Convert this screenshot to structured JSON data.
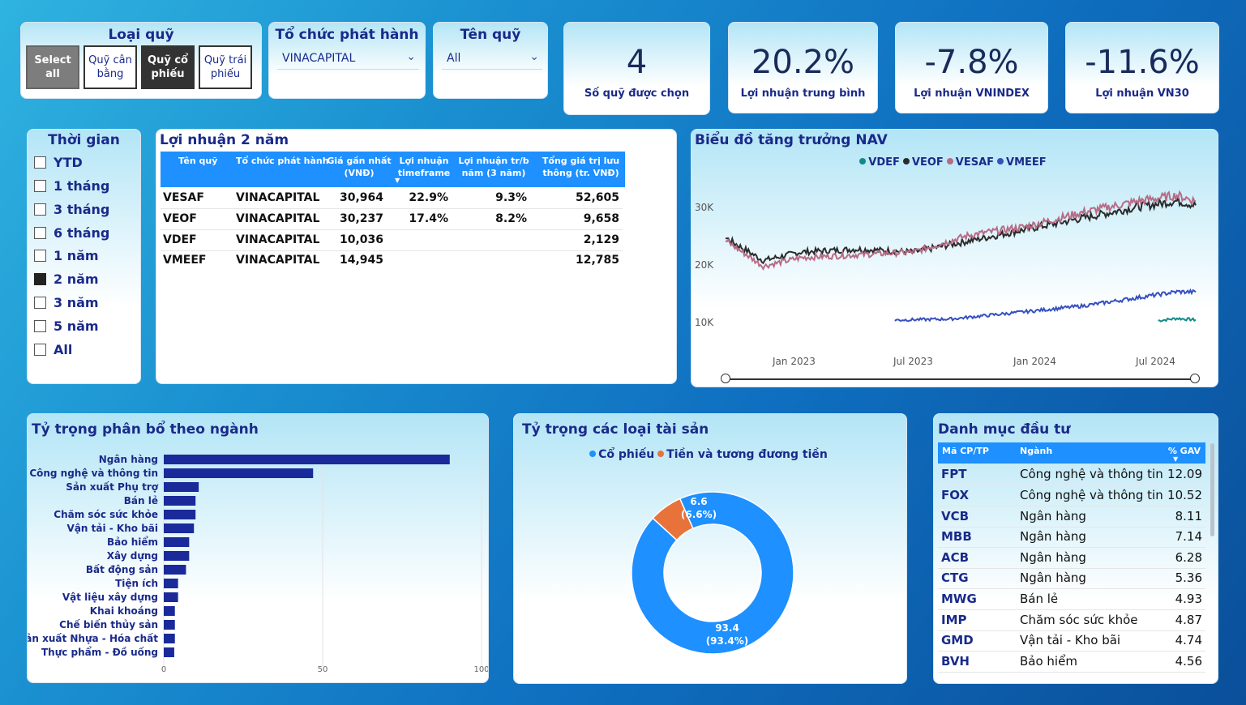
{
  "filters": {
    "fund_type": {
      "title": "Loại quỹ",
      "options": [
        "Select all",
        "Quỹ cân bằng",
        "Quỹ cổ phiếu",
        "Quỹ trái phiếu"
      ]
    },
    "issuer": {
      "title": "Tổ chức phát hành",
      "value": "VINACAPITAL"
    },
    "fund_name": {
      "title": "Tên quỹ",
      "value": "All"
    }
  },
  "kpis": [
    {
      "value": "4",
      "label": "Số quỹ được chọn"
    },
    {
      "value": "20.2%",
      "label": "Lợi nhuận trung bình"
    },
    {
      "value": "-7.8%",
      "label": "Lợi nhuận VNINDEX"
    },
    {
      "value": "-11.6%",
      "label": "Lợi nhuận VN30"
    }
  ],
  "time": {
    "title": "Thời gian",
    "options": [
      "YTD",
      "1 tháng",
      "3 tháng",
      "6 tháng",
      "1 năm",
      "2 năm",
      "3 năm",
      "5 năm",
      "All"
    ],
    "selected": "2 năm"
  },
  "returns_table": {
    "title": "Lợi nhuận 2 năm",
    "headers": [
      "Tên quỹ",
      "Tổ chức phát hành",
      "Giá gần nhất (VNĐ)",
      "Lợi nhuận timeframe",
      "Lợi nhuận tr/b năm (3 năm)",
      "Tổng giá trị lưu thông (tr. VNĐ)"
    ],
    "rows": [
      [
        "VESAF",
        "VINACAPITAL",
        "30,964",
        "22.9%",
        "9.3%",
        "52,605"
      ],
      [
        "VEOF",
        "VINACAPITAL",
        "30,237",
        "17.4%",
        "8.2%",
        "9,658"
      ],
      [
        "VDEF",
        "VINACAPITAL",
        "10,036",
        "",
        "",
        "2,129"
      ],
      [
        "VMEEF",
        "VINACAPITAL",
        "14,945",
        "",
        "",
        "12,785"
      ]
    ]
  },
  "nav_chart": {
    "title": "Biểu đồ tăng trưởng NAV",
    "y_ticks": [
      "30K",
      "20K",
      "10K"
    ],
    "x_ticks": [
      "Jan 2023",
      "Jul 2023",
      "Jan 2024",
      "Jul 2024"
    ]
  },
  "sector_chart": {
    "title": "Tỷ trọng phân bổ theo ngành",
    "x_ticks": [
      "0",
      "50",
      "100"
    ]
  },
  "asset_chart": {
    "title": "Tỷ trọng các loại tài sản",
    "labels": [
      {
        "value": "93.4",
        "pct": "(93.4%)"
      },
      {
        "value": "6.6",
        "pct": "(6.6%)"
      }
    ]
  },
  "portfolio": {
    "title": "Danh mục đầu tư",
    "headers": [
      "Mã CP/TP",
      "Ngành",
      "% GAV"
    ],
    "rows": [
      [
        "FPT",
        "Công nghệ và thông tin",
        "12.09"
      ],
      [
        "FOX",
        "Công nghệ và thông tin",
        "10.52"
      ],
      [
        "VCB",
        "Ngân hàng",
        "8.11"
      ],
      [
        "MBB",
        "Ngân hàng",
        "7.14"
      ],
      [
        "ACB",
        "Ngân hàng",
        "6.28"
      ],
      [
        "CTG",
        "Ngân hàng",
        "5.36"
      ],
      [
        "MWG",
        "Bán lẻ",
        "4.93"
      ],
      [
        "IMP",
        "Chăm sóc sức khỏe",
        "4.87"
      ],
      [
        "GMD",
        "Vận tải - Kho bãi",
        "4.74"
      ],
      [
        "BVH",
        "Bảo hiểm",
        "4.56"
      ]
    ]
  },
  "chart_data": [
    {
      "type": "line",
      "title": "Biểu đồ tăng trưởng NAV",
      "xlim": [
        "2022-09",
        "2024-09"
      ],
      "ylim": [
        5000,
        35000
      ],
      "legend": "top-center",
      "series": [
        {
          "name": "VDEF",
          "color": "#138a8a",
          "x": [
            "2024-08",
            "2024-09",
            "2024-10"
          ],
          "y": [
            9900,
            10300,
            10036
          ]
        },
        {
          "name": "VEOF",
          "color": "#2b2b2b",
          "x": [
            "2022-09",
            "2022-11",
            "2023-01",
            "2023-04",
            "2023-07",
            "2023-10",
            "2024-01",
            "2024-04",
            "2024-07",
            "2024-09",
            "2024-10"
          ],
          "y": [
            24500,
            20500,
            22000,
            22500,
            22000,
            24000,
            26000,
            28000,
            30000,
            31000,
            30237
          ]
        },
        {
          "name": "VESAF",
          "color": "#b86b86",
          "x": [
            "2022-09",
            "2022-11",
            "2023-01",
            "2023-04",
            "2023-07",
            "2023-10",
            "2024-01",
            "2024-04",
            "2024-07",
            "2024-09",
            "2024-10"
          ],
          "y": [
            24000,
            19500,
            21000,
            21500,
            22000,
            25000,
            26500,
            29000,
            31000,
            32000,
            30964
          ]
        },
        {
          "name": "VMEEF",
          "color": "#3650c0",
          "x": [
            "2023-06",
            "2023-09",
            "2024-01",
            "2024-04",
            "2024-07",
            "2024-09",
            "2024-10"
          ],
          "y": [
            10000,
            10200,
            11500,
            12500,
            14000,
            15000,
            14945
          ]
        }
      ]
    },
    {
      "type": "bar",
      "orientation": "horizontal",
      "title": "Tỷ trọng phân bổ theo ngành",
      "color": "#1a2a9a",
      "categories": [
        "Ngân hàng",
        "Công nghệ và thông tin",
        "Sản xuất Phụ trợ",
        "Bán lẻ",
        "Chăm sóc sức khỏe",
        "Vận tải - Kho bãi",
        "Bảo hiểm",
        "Xây dựng",
        "Bất động sản",
        "Tiện ích",
        "Vật liệu xây dựng",
        "Khai khoáng",
        "Chế biến thủy sản",
        "Sản xuất Nhựa - Hóa chất",
        "Thực phẩm - Đồ uống"
      ],
      "values": [
        90,
        47,
        11,
        10,
        10,
        9.5,
        8,
        8,
        7,
        4.5,
        4.5,
        3.5,
        3.5,
        3.5,
        3.3
      ],
      "xlim": [
        0,
        100
      ],
      "grid": true
    },
    {
      "type": "pie",
      "title": "Tỷ trọng các loại tài sản",
      "legend": "top-center",
      "categories": [
        "Cổ phiếu",
        "Tiền và tương đương tiền"
      ],
      "values": [
        93.4,
        6.6
      ],
      "colors": [
        "#1e90ff",
        "#e8733a"
      ]
    }
  ]
}
